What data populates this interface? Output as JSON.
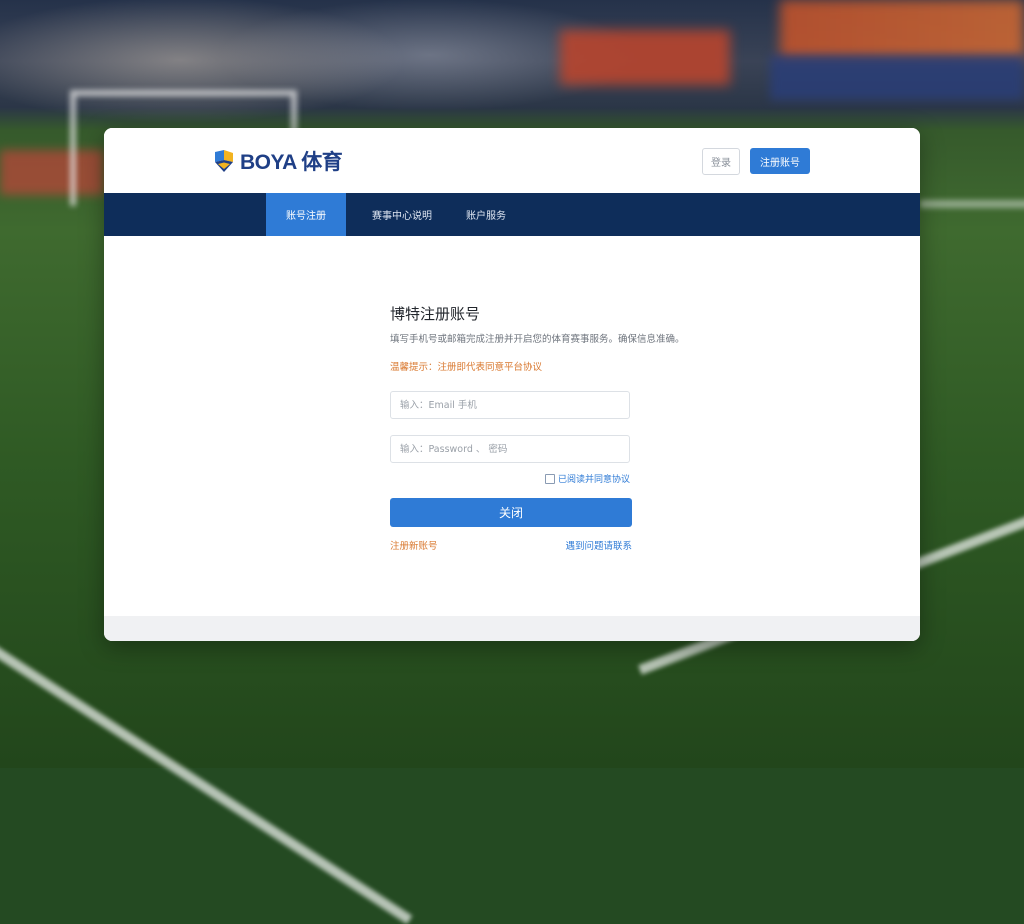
{
  "brand": {
    "name": "BOYA 体育",
    "accent": "#2f7bd6",
    "navy": "#0e2d5a",
    "orange": "#d9782f"
  },
  "header": {
    "login_label": "登录",
    "register_label": "注册账号"
  },
  "nav": {
    "items": [
      {
        "label": "账号注册",
        "active": true
      },
      {
        "label": "赛事中心说明",
        "active": false
      },
      {
        "label": "账户服务",
        "active": false
      }
    ]
  },
  "form": {
    "title": "博特注册账号",
    "description": "填写手机号或邮箱完成注册并开启您的体育赛事服务。确保信息准确。",
    "notice": "温馨提示：注册即代表同意平台协议",
    "field_account_placeholder": "输入：Email 手机",
    "field_password_placeholder": "输入：Password 、 密码",
    "checkbox_label": "已阅读并同意协议",
    "submit_label": "关闭",
    "link_left": "注册新账号",
    "link_right": "遇到问题请联系"
  }
}
